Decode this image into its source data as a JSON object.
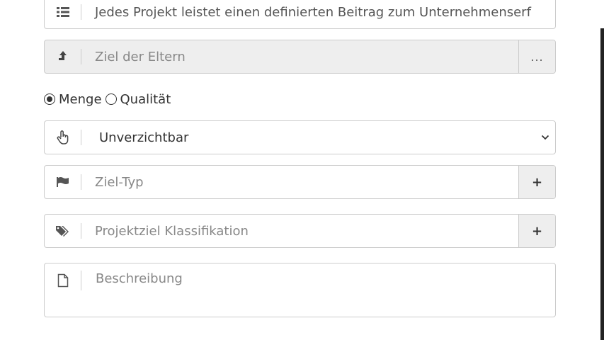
{
  "form": {
    "title_field": {
      "value": "Jedes Projekt leistet einen definierten Beitrag zum Unternehmenserf",
      "icon": "list-icon"
    },
    "parent_goal": {
      "placeholder": "Ziel der Eltern",
      "icon": "arrow-up-icon",
      "button_label": "..."
    },
    "measure_type": {
      "options": [
        {
          "label": "Menge",
          "selected": true
        },
        {
          "label": "Qualität",
          "selected": false
        }
      ]
    },
    "priority": {
      "value": "Unverzichtbar",
      "icon": "hand-pointer-icon",
      "dropdown_icon": "chevron-down-icon"
    },
    "goal_type": {
      "placeholder": "Ziel-Typ",
      "icon": "flag-icon",
      "button_label": "+"
    },
    "classification": {
      "placeholder": "Projektziel Klassifikation",
      "icon": "tags-icon",
      "button_label": "+"
    },
    "description": {
      "placeholder": "Beschreibung",
      "icon": "file-icon"
    }
  }
}
